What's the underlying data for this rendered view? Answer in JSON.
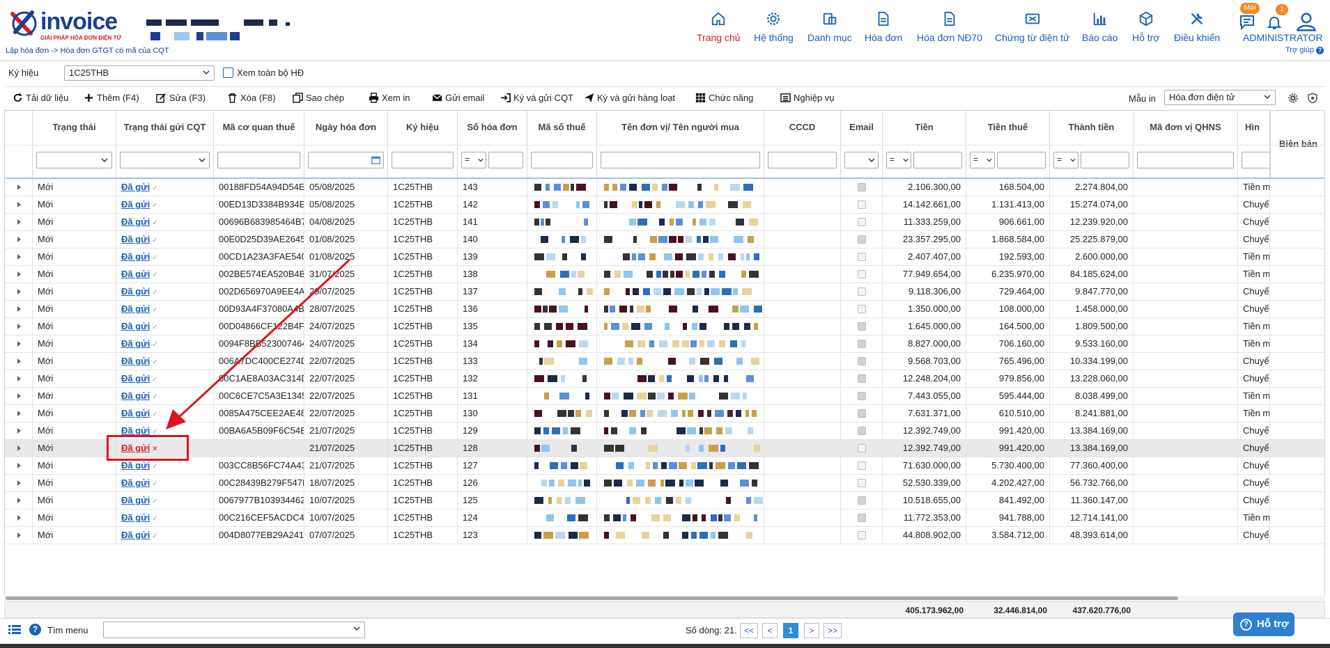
{
  "header": {
    "logo_text": "invoice",
    "logo_sub": "GIẢI PHÁP HÓA ĐƠN ĐIỆN TỬ",
    "breadcrumb": "Lập hóa đơn -> Hóa đơn GTGT có mã của CQT",
    "nav": [
      {
        "label": "Trang chủ",
        "icon": "home-icon"
      },
      {
        "label": "Hệ thống",
        "icon": "gear-icon"
      },
      {
        "label": "Danh mục",
        "icon": "folder-icon"
      },
      {
        "label": "Hóa đơn",
        "icon": "document-icon"
      },
      {
        "label": "Hóa đơn NĐ70",
        "icon": "document-icon"
      },
      {
        "label": "Chứng từ điện tử",
        "icon": "certificate-icon"
      },
      {
        "label": "Báo cáo",
        "icon": "bar-chart-icon"
      },
      {
        "label": "Hỗ trợ",
        "icon": "cube-icon"
      },
      {
        "label": "Điều khiển",
        "icon": "tools-icon"
      }
    ],
    "message_badge": "Mới",
    "notification_count": "1",
    "user": "ADMINISTRATOR",
    "help_link": "Trợ giúp"
  },
  "filter": {
    "kyhieu_label": "Ký hiệu",
    "kyhieu_value": "1C25THB",
    "view_all_label": "Xem toàn bộ HĐ"
  },
  "toolbar": {
    "reload": "Tải dữ liệu",
    "add": "Thêm (F4)",
    "edit": "Sửa (F3)",
    "delete": "Xóa (F8)",
    "copy": "Sao chép",
    "print": "Xem in",
    "email": "Gửi email",
    "sign_send": "Ký và gửi CQT",
    "sign_batch": "Ký và gửi hàng loạt",
    "functions": "Chức năng",
    "operations": "Nghiệp vụ",
    "template_label": "Mẫu in",
    "template_value": "Hóa đơn điện tử"
  },
  "columns": [
    "Trạng thái",
    "Trạng thái gửi CQT",
    "Mã cơ quan thuế",
    "Ngày hóa đơn",
    "Ký hiệu",
    "Số hóa đơn",
    "Mã số thuế",
    "Tên đơn vị/ Tên người mua",
    "CCCD",
    "Email",
    "Tiền",
    "Tiền thuế",
    "Thành tiền",
    "Mã đơn vị QHNS",
    "Hìn",
    "Biên bản"
  ],
  "filter_ops": {
    "so": "=",
    "tien": "=",
    "thue": "=",
    "thanh": "="
  },
  "rows": [
    {
      "status": "Mới",
      "sent": "Đã gửi",
      "code": "00188FD54A94D54EI",
      "date": "05/08/2025",
      "kh": "1C25THB",
      "no": "143",
      "email": true,
      "tien": "2.106.300,00",
      "thue": "168.504,00",
      "thanh": "2.274.804,00",
      "hinh": "Tiền m"
    },
    {
      "status": "Mới",
      "sent": "Đã gửi",
      "code": "00ED13D3384B934E",
      "date": "05/08/2025",
      "kh": "1C25THB",
      "no": "142",
      "email": false,
      "tien": "14.142.661,00",
      "thue": "1.131.413,00",
      "thanh": "15.274.074,00",
      "hinh": "Chuyể"
    },
    {
      "status": "Mới",
      "sent": "Đã gửi",
      "code": "00696B683985464B7",
      "date": "04/08/2025",
      "kh": "1C25THB",
      "no": "141",
      "email": false,
      "tien": "11.333.259,00",
      "thue": "906.661,00",
      "thanh": "12.239.920,00",
      "hinh": "Chuyể"
    },
    {
      "status": "Mới",
      "sent": "Đã gửi",
      "code": "00E0D25D39AE2645",
      "date": "01/08/2025",
      "kh": "1C25THB",
      "no": "140",
      "email": true,
      "tien": "23.357.295,00",
      "thue": "1.868.584,00",
      "thanh": "25.225.879,00",
      "hinh": "Chuyể"
    },
    {
      "status": "Mới",
      "sent": "Đã gửi",
      "code": "00CD1A23A3FAE540",
      "date": "01/08/2025",
      "kh": "1C25THB",
      "no": "139",
      "email": false,
      "tien": "2.407.407,00",
      "thue": "192.593,00",
      "thanh": "2.600.000,00",
      "hinh": "Tiền m"
    },
    {
      "status": "Mới",
      "sent": "Đã gửi",
      "code": "002BE574EA520B4B",
      "date": "31/07/2025",
      "kh": "1C25THB",
      "no": "138",
      "email": false,
      "tien": "77.949.654,00",
      "thue": "6.235.970,00",
      "thanh": "84.185.624,00",
      "hinh": "Tiền m"
    },
    {
      "status": "Mới",
      "sent": "Đã gửi",
      "code": "002D656970A9EE4A",
      "date": "29/07/2025",
      "kh": "1C25THB",
      "no": "137",
      "email": false,
      "tien": "9.118.306,00",
      "thue": "729.464,00",
      "thanh": "9.847.770,00",
      "hinh": "Chuyể"
    },
    {
      "status": "Mới",
      "sent": "Đã gửi",
      "code": "00D93A4F37080A4B",
      "date": "28/07/2025",
      "kh": "1C25THB",
      "no": "136",
      "email": false,
      "tien": "1.350.000,00",
      "thue": "108.000,00",
      "thanh": "1.458.000,00",
      "hinh": "Chuyể"
    },
    {
      "status": "Mới",
      "sent": "Đã gửi",
      "code": "00D04866CF122B4F",
      "date": "24/07/2025",
      "kh": "1C25THB",
      "no": "135",
      "email": true,
      "tien": "1.645.000,00",
      "thue": "164.500,00",
      "thanh": "1.809.500,00",
      "hinh": "Tiền m"
    },
    {
      "status": "Mới",
      "sent": "Đã gửi",
      "code": "0094F8BB523007464",
      "date": "24/07/2025",
      "kh": "1C25THB",
      "no": "134",
      "email": true,
      "tien": "8.827.000,00",
      "thue": "706.160,00",
      "thanh": "9.533.160,00",
      "hinh": "Tiền m"
    },
    {
      "status": "Mới",
      "sent": "Đã gửi",
      "code": "006A7DC400CE274D",
      "date": "22/07/2025",
      "kh": "1C25THB",
      "no": "133",
      "email": true,
      "tien": "9.568.703,00",
      "thue": "765.496,00",
      "thanh": "10.334.199,00",
      "hinh": "Chuyể"
    },
    {
      "status": "Mới",
      "sent": "Đã gửi",
      "code": "00C1AE8A03AC314D",
      "date": "22/07/2025",
      "kh": "1C25THB",
      "no": "132",
      "email": true,
      "tien": "12.248.204,00",
      "thue": "979.856,00",
      "thanh": "13.228.060,00",
      "hinh": "Chuyể"
    },
    {
      "status": "Mới",
      "sent": "Đã gửi",
      "code": "00C6CE7C5A3E1345",
      "date": "22/07/2025",
      "kh": "1C25THB",
      "no": "131",
      "email": true,
      "tien": "7.443.055,00",
      "thue": "595.444,00",
      "thanh": "8.038.499,00",
      "hinh": "Tiền m"
    },
    {
      "status": "Mới",
      "sent": "Đã gửi",
      "code": "0085A475CEE2AE48",
      "date": "22/07/2025",
      "kh": "1C25THB",
      "no": "130",
      "email": true,
      "tien": "7.631.371,00",
      "thue": "610.510,00",
      "thanh": "8.241.881,00",
      "hinh": "Tiền m"
    },
    {
      "status": "Mới",
      "sent": "Đã gửi",
      "code": "00BA6A5B09F6C54B",
      "date": "21/07/2025",
      "kh": "1C25THB",
      "no": "129",
      "email": true,
      "tien": "12.392.749,00",
      "thue": "991.420,00",
      "thanh": "13.384.169,00",
      "hinh": "Chuyể"
    },
    {
      "status": "Mới",
      "sent": "Đã gửi",
      "code": "",
      "date": "21/07/2025",
      "kh": "1C25THB",
      "no": "128",
      "email": false,
      "tien": "12.392.749,00",
      "thue": "991.420,00",
      "thanh": "13.384.169,00",
      "hinh": "Chuyể",
      "error": true
    },
    {
      "status": "Mới",
      "sent": "Đã gửi",
      "code": "003CC8B56FC74A43",
      "date": "21/07/2025",
      "kh": "1C25THB",
      "no": "127",
      "email": false,
      "tien": "71.630.000,00",
      "thue": "5.730.400,00",
      "thanh": "77.360.400,00",
      "hinh": "Chuyể"
    },
    {
      "status": "Mới",
      "sent": "Đã gửi",
      "code": "00C28439B279F547E",
      "date": "18/07/2025",
      "kh": "1C25THB",
      "no": "126",
      "email": false,
      "tien": "52.530.339,00",
      "thue": "4.202.427,00",
      "thanh": "56.732.766,00",
      "hinh": "Chuyể"
    },
    {
      "status": "Mới",
      "sent": "Đã gửi",
      "code": "0067977B103934462",
      "date": "10/07/2025",
      "kh": "1C25THB",
      "no": "125",
      "email": true,
      "tien": "10.518.655,00",
      "thue": "841.492,00",
      "thanh": "11.360.147,00",
      "hinh": "Chuyể"
    },
    {
      "status": "Mới",
      "sent": "Đã gửi",
      "code": "00C216CEF5ACDC45",
      "date": "10/07/2025",
      "kh": "1C25THB",
      "no": "124",
      "email": true,
      "tien": "11.772.353,00",
      "thue": "941.788,00",
      "thanh": "12.714.141,00",
      "hinh": "Tiền m"
    },
    {
      "status": "Mới",
      "sent": "Đã gửi",
      "code": "004D8077EB29A241E",
      "date": "07/07/2025",
      "kh": "1C25THB",
      "no": "123",
      "email": false,
      "tien": "44.808.902,00",
      "thue": "3.584.712,00",
      "thanh": "48.393.614,00",
      "hinh": "Chuyể"
    }
  ],
  "totals": {
    "tien": "405.173.962,00",
    "thue": "32.446.814,00",
    "thanh": "437.620.776,00"
  },
  "footer": {
    "menu_search": "Tìm menu",
    "row_count": "Số dòng: 21.",
    "pager": [
      "<<",
      "<",
      "1",
      ">",
      ">>"
    ],
    "support": "Hỗ trợ"
  },
  "colors": {
    "brand": "#1b5fb8",
    "active": "#d32027",
    "annotation": "#e0141e"
  }
}
